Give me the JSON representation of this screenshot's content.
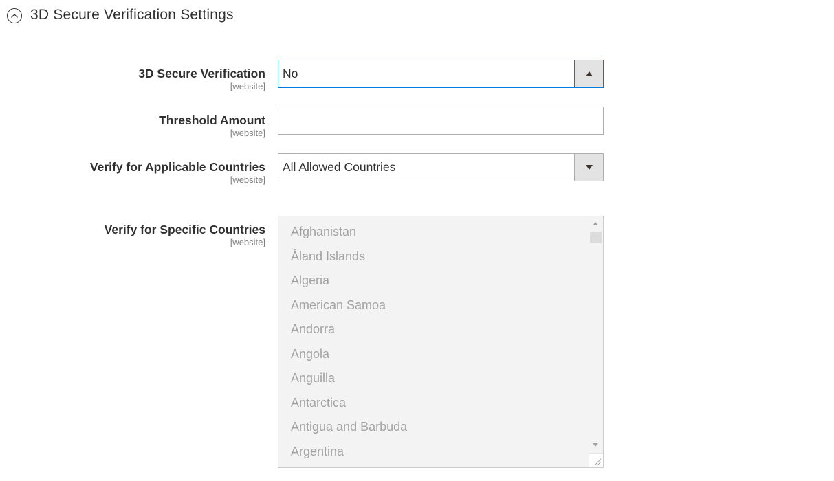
{
  "section": {
    "title": "3D Secure Verification Settings",
    "icon": "chevron-up-circle-icon"
  },
  "fields": {
    "verification": {
      "label": "3D Secure Verification",
      "scope": "[website]",
      "value": "No"
    },
    "threshold": {
      "label": "Threshold Amount",
      "scope": "[website]",
      "value": "",
      "placeholder": ""
    },
    "applicable": {
      "label": "Verify for Applicable Countries",
      "scope": "[website]",
      "value": "All Allowed Countries"
    },
    "specific": {
      "label": "Verify for Specific Countries",
      "scope": "[website]",
      "options": [
        "Afghanistan",
        "Åland Islands",
        "Algeria",
        "American Samoa",
        "Andorra",
        "Angola",
        "Anguilla",
        "Antarctica",
        "Antigua and Barbuda",
        "Argentina"
      ]
    }
  },
  "colors": {
    "focus_border": "#007bdb",
    "disabled_bg": "#f3f3f3",
    "disabled_text": "#a3a3a3"
  }
}
